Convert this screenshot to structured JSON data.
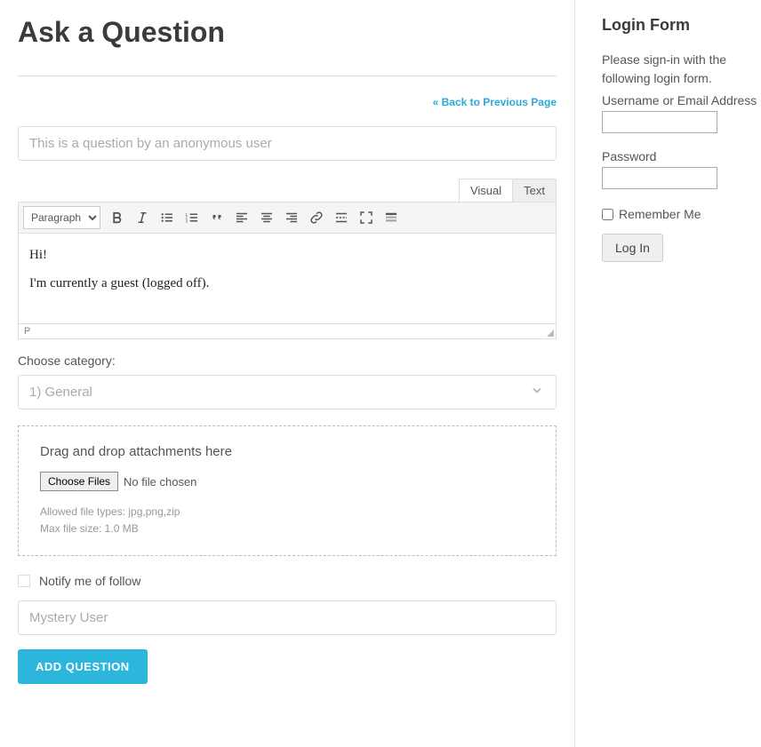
{
  "page": {
    "title": "Ask a Question",
    "back_link": "« Back to Previous Page"
  },
  "question": {
    "title_placeholder": "This is a question by an anonymous user",
    "username_placeholder": "Mystery User",
    "submit_label": "ADD QUESTION"
  },
  "editor": {
    "tabs": {
      "visual": "Visual",
      "text": "Text",
      "active": "visual"
    },
    "format_select": "Paragraph",
    "content_line1": "Hi!",
    "content_line2": "I'm currently a guest (logged off).",
    "status_path": "P"
  },
  "category": {
    "label": "Choose category:",
    "selected": "1) General"
  },
  "attachments": {
    "title": "Drag and drop attachments here",
    "button": "Choose Files",
    "status": "No file chosen",
    "hint_types": "Allowed file types: jpg,png,zip",
    "hint_size": "Max file size: 1.0 MB"
  },
  "notify": {
    "label": "Notify me of follow",
    "checked": false
  },
  "login": {
    "title": "Login Form",
    "intro": "Please sign-in with the following login form.",
    "user_label": "Username or Email Address",
    "pass_label": "Password",
    "remember": "Remember Me",
    "button": "Log In"
  },
  "colors": {
    "accent": "#2cb6dc",
    "link": "#2aa9d4"
  }
}
